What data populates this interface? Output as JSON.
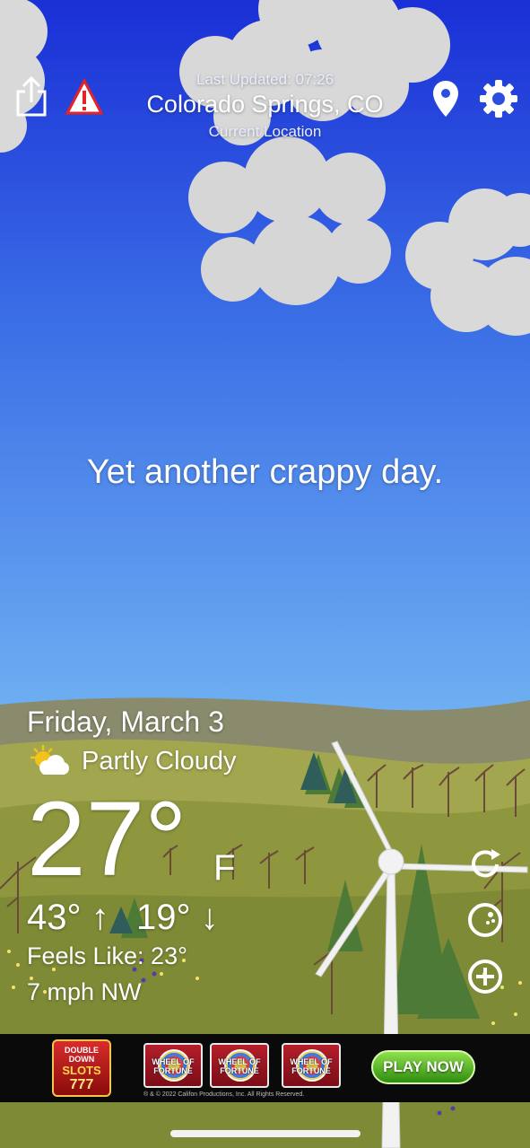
{
  "header": {
    "last_updated": "Last Updated: 07:26",
    "city": "Colorado Springs, CO",
    "location_note": "Current Location"
  },
  "message": "Yet another crappy day.",
  "weather": {
    "date": "Friday, March 3",
    "condition": "Partly Cloudy",
    "condition_icon": "partly-cloudy-icon",
    "temperature": "27°",
    "unit": "F",
    "high": "43° ↑",
    "low": "19° ↓",
    "feels_like": "Feels Like: 23°",
    "wind": "7 mph NW"
  },
  "icons": {
    "share": "share-icon",
    "alert": "alert-icon",
    "location": "location-pin-icon",
    "settings": "gear-icon",
    "refresh": "refresh-icon",
    "radar": "radar-icon",
    "add": "add-location-icon"
  },
  "ad": {
    "brand": [
      "DOUBLE",
      "DOWN",
      "SLOTS",
      "777"
    ],
    "reel_label": "WHEEL OF FORTUNE",
    "cta": "PLAY NOW",
    "copyright": "® & © 2022 Califon Productions, Inc. All Rights Reserved."
  },
  "colors": {
    "sky_top": "#1a2fd6",
    "sky_bottom": "#6fb0f2",
    "alert_red": "#e2232a",
    "cta_green": "#3aa118"
  }
}
